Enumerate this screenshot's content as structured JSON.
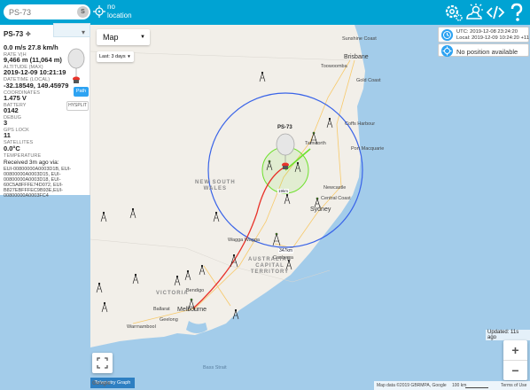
{
  "topbar": {
    "search_placeholder": "PS-73",
    "search_button": "S",
    "location_line1": "no",
    "location_line2": "location",
    "icons": [
      "gear-icon",
      "weather-icon",
      "code-icon",
      "help-icon"
    ]
  },
  "panel": {
    "title": "PS-73 ✧",
    "chevron": "▾",
    "rows": [
      {
        "value": "0.0 m/s 27.8 km/h",
        "label": "RATE V|H"
      },
      {
        "value": "9,466 m (11,064 m)",
        "label": "ALTITUDE (MAX)"
      },
      {
        "value": "2019-12-09 10:21:19",
        "label": "DATETIME (LOCAL)"
      },
      {
        "value": "-32.18549, 149.45979",
        "label": "COORDINATES"
      },
      {
        "value": "1.475 V",
        "label": "BATTERY"
      },
      {
        "value": "0142",
        "label": "DEBUG"
      },
      {
        "value": "3",
        "label": "GPS LOCK"
      },
      {
        "value": "11",
        "label": "SATELLITES"
      },
      {
        "value": "0.0°C",
        "label": "TEMPERATURE"
      }
    ],
    "received": "Received 3m ago via:",
    "receivers": [
      "EUI-00800000A0003D1B, EUI-",
      "00800000A0003D15, EUI-",
      "00800000A0003D18, EUI-",
      "60C5A8FFFE74D072, EUI-",
      "B827EBFFFEC9B93E,EUI-",
      "00800000A0003FC4"
    ],
    "path_button": "Path",
    "hysplit_button": "HYSPLIT"
  },
  "map": {
    "type_select": "Map",
    "range_select": "Last: 3 days",
    "balloon_label": "PS-73",
    "distance_label": "347km",
    "small_distance_label": "19km",
    "updated": "Updated: 11s ago",
    "zoom_in": "+",
    "zoom_out": "−",
    "telemetry_button": "Telemetry Graph",
    "google": "Google",
    "attribution": [
      "Map data ©2019 GBRMPA, Google",
      "100 km",
      "Terms of Use"
    ],
    "labels": {
      "nsw": [
        "NEW SOUTH",
        "WALES"
      ],
      "act": [
        "AUSTRALIAN",
        "CAPITAL",
        "TERRITORY"
      ],
      "victoria": "VICTORIA",
      "sunshine_coast": "Sunshine Coast",
      "brisbane": "Brisbane",
      "toowoomba": "Toowoomba",
      "gold_coast": "Gold Coast",
      "coffs_harbour": "Coffs Harbour",
      "tamworth": "Tamworth",
      "port_macquarie": "Port Macquarie",
      "newcastle": "Newcastle",
      "central_coast": "Central Coast",
      "sydney": "Sydney",
      "wagga_wagga": "Wagga Wagga",
      "canberra": "Canberra",
      "bendigo": "Bendigo",
      "ballarat": "Ballarat",
      "melbourne": "Melbourne",
      "geelong": "Geelong",
      "warrnambool": "Warrnambool",
      "bass_strait": "Bass Strait"
    }
  },
  "time": {
    "utc": "UTC: 2019-12-08 23:24:20",
    "local": "Local: 2019-12-09 10:24:20 +11"
  },
  "position": {
    "text": "No position available"
  },
  "colors": {
    "topbar": "#00a3d3",
    "land": "#f2efe9",
    "water": "#a3ccea",
    "accent": "#2ea3f2",
    "track": "#e8332a",
    "predicted": "#6ee02d",
    "range_circle": "#3a64e8"
  }
}
